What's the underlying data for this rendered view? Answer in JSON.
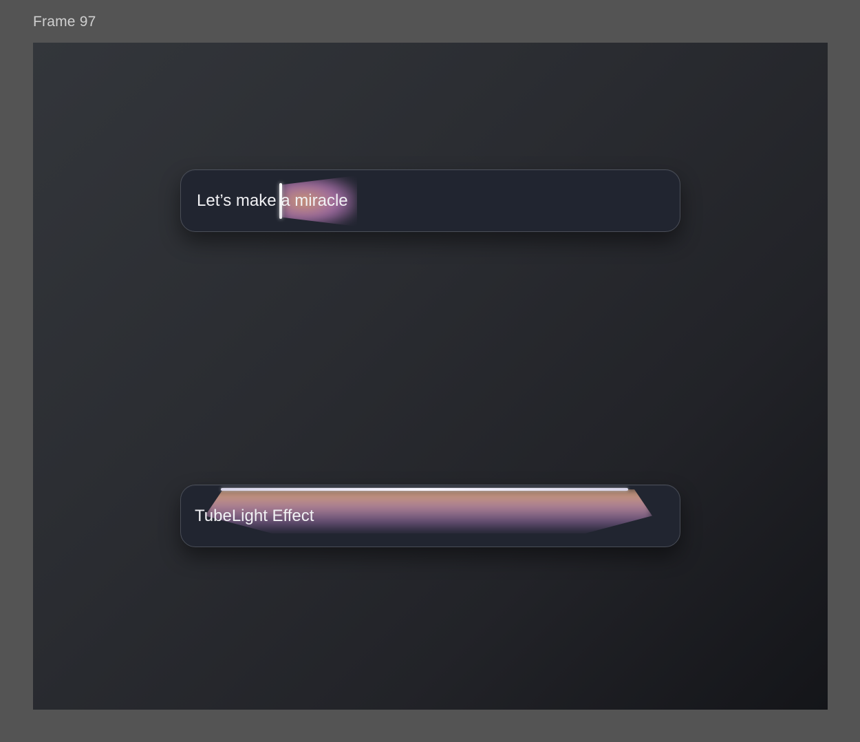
{
  "canvas": {
    "frame_label": "Frame 97"
  },
  "field_one": {
    "text": "Let’s make a miracle"
  },
  "field_two": {
    "text": "TubeLight Effect"
  },
  "colors": {
    "canvas_bg": "#545454",
    "frame_bg_start": "#33363b",
    "frame_bg_end": "#141519",
    "field_bg": "#212530",
    "field_border": "#4a4e58",
    "glow_warm": "#e8aa78",
    "glow_purple": "#c882c8",
    "text": "#f1f1f4"
  }
}
